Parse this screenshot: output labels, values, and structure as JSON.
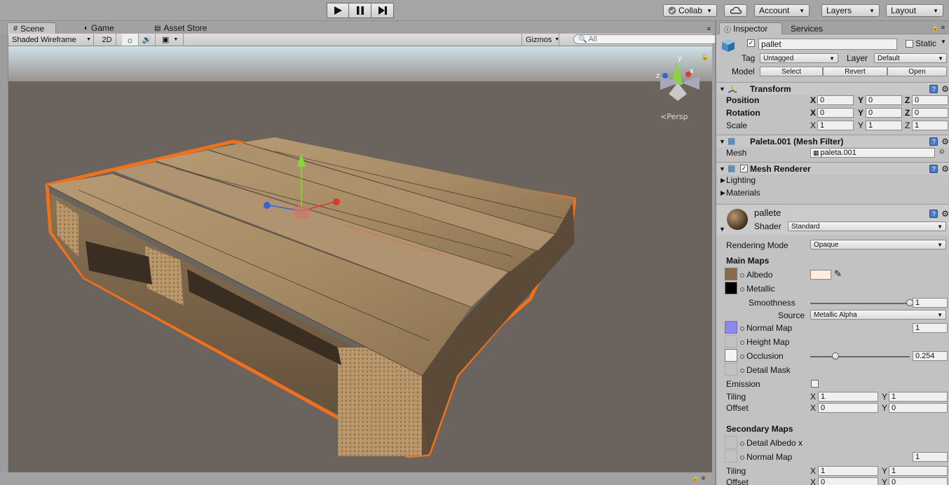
{
  "toolbar": {
    "collab_label": "Collab",
    "account_label": "Account",
    "layers_label": "Layers",
    "layout_label": "Layout"
  },
  "scene_tabs": {
    "scene": "Scene",
    "game": "Game",
    "asset_store": "Asset Store"
  },
  "scene_bar": {
    "draw_mode": "Shaded Wireframe",
    "mode_2d": "2D",
    "gizmos": "Gizmos",
    "search_placeholder": "All"
  },
  "viewport": {
    "projection": "Persp",
    "axis_x": "x",
    "axis_y": "y",
    "axis_z": "z"
  },
  "inspector": {
    "tabs": {
      "inspector": "Inspector",
      "services": "Services"
    },
    "object_name": "pallet",
    "static_label": "Static",
    "tag_label": "Tag",
    "tag_value": "Untagged",
    "layer_label": "Layer",
    "layer_value": "Default",
    "model_label": "Model",
    "model_buttons": {
      "select": "Select",
      "revert": "Revert",
      "open": "Open"
    },
    "transform": {
      "title": "Transform",
      "position_label": "Position",
      "rotation_label": "Rotation",
      "scale_label": "Scale",
      "position": {
        "x": "0",
        "y": "0",
        "z": "0"
      },
      "rotation": {
        "x": "0",
        "y": "0",
        "z": "0"
      },
      "scale": {
        "x": "1",
        "y": "1",
        "z": "1"
      },
      "axis_labels": {
        "x": "X",
        "y": "Y",
        "z": "Z"
      }
    },
    "mesh_filter": {
      "title": "Paleta.001 (Mesh Filter)",
      "mesh_label": "Mesh",
      "mesh_value": "paleta.001"
    },
    "mesh_renderer": {
      "title": "Mesh Renderer",
      "lighting": "Lighting",
      "materials": "Materials"
    },
    "material": {
      "name": "pallete",
      "shader_label": "Shader",
      "shader_value": "Standard",
      "rendering_mode_label": "Rendering Mode",
      "rendering_mode_value": "Opaque",
      "main_maps_label": "Main Maps",
      "albedo": "Albedo",
      "albedo_color": "#fbeedc",
      "metallic": "Metallic",
      "smoothness_label": "Smoothness",
      "smoothness_value": "1",
      "smoothness_level": 1.0,
      "source_label": "Source",
      "source_value": "Metallic Alpha",
      "normal_map": "Normal Map",
      "normal_map_value": "1",
      "height_map": "Height Map",
      "occlusion": "Occlusion",
      "occlusion_value": "0.254",
      "occlusion_level": 0.254,
      "detail_mask": "Detail Mask",
      "emission": "Emission",
      "tiling_label": "Tiling",
      "offset_label": "Offset",
      "tiling": {
        "x": "1",
        "y": "1"
      },
      "offset": {
        "x": "0",
        "y": "0"
      },
      "secondary_maps_label": "Secondary Maps",
      "detail_albedo": "Detail Albedo x",
      "secondary_normal_map": "Normal Map",
      "secondary_normal_value": "1",
      "secondary_tiling": {
        "x": "1",
        "y": "1"
      },
      "secondary_offset": {
        "x": "0",
        "y": "0"
      }
    }
  },
  "colors": {
    "selection_outline": "#f0701c",
    "gizmo_x": "#d63a2a",
    "gizmo_y": "#8ad43a",
    "gizmo_z": "#3a62d6",
    "ground": "#6a625d"
  }
}
